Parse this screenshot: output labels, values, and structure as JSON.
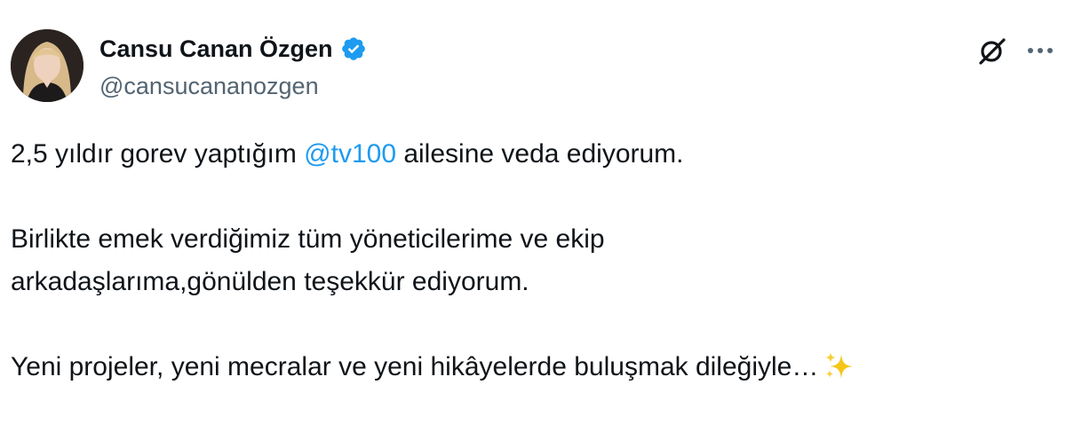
{
  "author": {
    "display_name": "Cansu Canan Özgen",
    "handle": "@cansucananozgen",
    "verified": true,
    "verified_color": "#1d9bf0"
  },
  "actions": {
    "grok_icon": "grok-icon",
    "more_icon": "more-options-icon"
  },
  "tweet": {
    "line1_before": "2,5 yıldır gorev yaptığım ",
    "line1_mention": "@tv100",
    "line1_after": " ailesine veda ediyorum.",
    "para2": "Birlikte emek verdiğimiz tüm yöneticilerime ve ekip\narkadaşlarıma,gönülden teşekkür ediyorum.",
    "para3": "Yeni projeler, yeni mecralar ve yeni hikâyelerde buluşmak dileğiyle…",
    "emoji_icon": "sparkles-icon"
  },
  "colors": {
    "text": "#0f1419",
    "secondary": "#536471",
    "link": "#1d9bf0",
    "sparkle": "#f5c518"
  }
}
